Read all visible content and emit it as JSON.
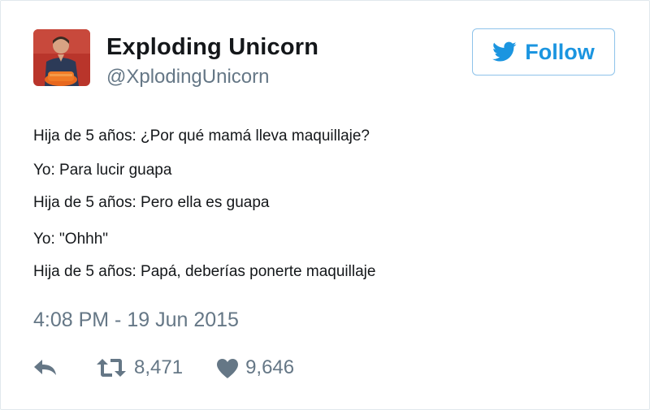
{
  "user": {
    "display_name": "Exploding Unicorn",
    "handle": "@XplodingUnicorn"
  },
  "follow_button": {
    "label": "Follow",
    "icon": "twitter-bird-icon",
    "color": "#1b95e0"
  },
  "tweet": {
    "lines": [
      "Hija de 5 años: ¿Por qué mamá lleva maquillaje?",
      "Yo: Para lucir guapa",
      "Hija de 5 años: Pero ella es guapa",
      "Yo: \"Ohhh\"",
      "Hija de 5 años: Papá, deberías ponerte maquillaje"
    ],
    "timestamp": "4:08 PM - 19 Jun 2015"
  },
  "actions": {
    "reply_icon": "reply-icon",
    "retweet_icon": "retweet-icon",
    "retweet_count": "8,471",
    "like_icon": "heart-icon",
    "like_count": "9,646"
  },
  "colors": {
    "text": "#14171a",
    "muted": "#657786",
    "border": "#e1e8ed",
    "accent": "#1b95e0"
  }
}
